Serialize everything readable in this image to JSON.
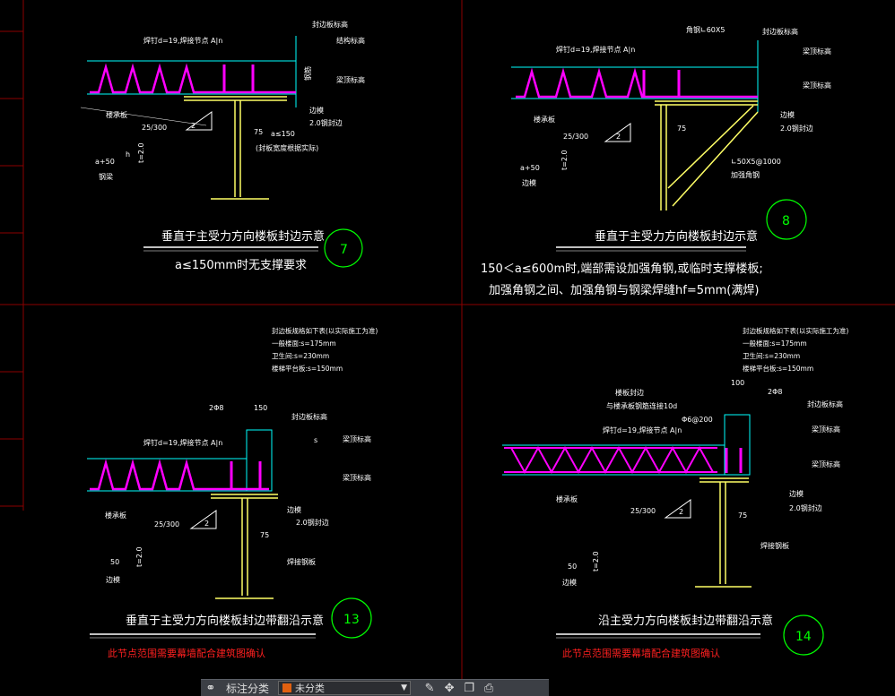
{
  "colors": {
    "frame": "#8b0000",
    "white": "#ffffff",
    "cyan": "#00ffff",
    "magenta": "#ff00ff",
    "yellow": "#ffff66",
    "green": "#00ff00",
    "red": "#ff2020"
  },
  "panels": {
    "p7": {
      "number": "7",
      "title": "垂直于主受力方向楼板封边示意",
      "note": "a≤150mm时无支撑要求",
      "labels": {
        "stud": "焊钉d=19,焊接节点 A|n",
        "deck": "楼承板",
        "slope": "25/300",
        "a50": "a+50",
        "t": "t=2.0",
        "h": "h",
        "floorlevel": "结构标高",
        "beamtop": "梁顶标高",
        "closure": "2.0钢封边",
        "hd": "钢筋",
        "a150": "a≤150",
        "cut": "(封板宽度根据实际)",
        "seal": "封边板标高",
        "edge": "边模",
        "seam": "2",
        "n75": "75",
        "bg": "钢梁"
      }
    },
    "p8": {
      "number": "8",
      "title": "垂直于主受力方向楼板封边示意",
      "note1": "150＜a≤600m时,端部需设加强角钢,或临时支撑楼板;",
      "note2": "加强角钢之间、加强角钢与钢梁焊缝hf=5mm(满焊)",
      "labels": {
        "stud": "焊钉d=19,焊接节点 A|n",
        "angle": "角钢∟60X5",
        "angle2": "∟50X5@1000",
        "slope": "25/300",
        "a50": "a+50",
        "t": "t=2.0",
        "seal": "封边板标高",
        "beamtop": "梁顶标高",
        "closure": "2.0钢封边",
        "deck": "楼承板",
        "seam": "2",
        "n75": "75",
        "support": "加强角钢",
        "edge": "边模"
      }
    },
    "p13": {
      "number": "13",
      "title": "垂直于主受力方向楼板封边带翻沿示意",
      "red": "此节点范围需要幕墙配合建筑图确认",
      "notes": [
        "封边板规格如下表(以实际施工为准)",
        "一般楼面:s=175mm",
        "卫生间:s=230mm",
        "楼梯平台板:s=150mm"
      ],
      "labels": {
        "bar": "2Φ8",
        "n150": "150",
        "stud": "焊钉d=19,焊接节点 A|n",
        "slope": "25/300",
        "n50": "50",
        "t": "t=2.0",
        "seal": "封边板标高",
        "beamtop": "梁顶标高",
        "closure": "2.0钢封边",
        "deck": "楼承板",
        "weld": "焊接钢板",
        "seam": "2",
        "n75": "75",
        "s": "s",
        "edge": "边模"
      }
    },
    "p14": {
      "number": "14",
      "title": "沿主受力方向楼板封边带翻沿示意",
      "red": "此节点范围需要幕墙配合建筑图确认",
      "notes": [
        "封边板规格如下表(以实际施工为准)",
        "一般楼面:s=175mm",
        "卫生间:s=230mm",
        "楼梯平台板:s=150mm"
      ],
      "labels": {
        "n100": "100",
        "bar": "2Φ8",
        "dist": "Φ6@200",
        "wall": "楼板封边",
        "rebar": "与楼承板钢筋连接10d",
        "stud": "焊钉d=19,焊接节点 A|n",
        "slope": "25/300",
        "n50": "50",
        "t": "t=2.0",
        "seal": "封边板标高",
        "beamtop": "梁顶标高",
        "closure": "2.0钢封边",
        "deck": "楼承板",
        "weld": "焊接钢板",
        "seam": "2",
        "n75": "75",
        "edge": "边模"
      }
    }
  },
  "toolbar": {
    "label": "标注分类",
    "select": "未分类",
    "icons": [
      "link-icon",
      "pencil-icon",
      "move-icon",
      "copy-icon",
      "stamp-icon"
    ]
  }
}
